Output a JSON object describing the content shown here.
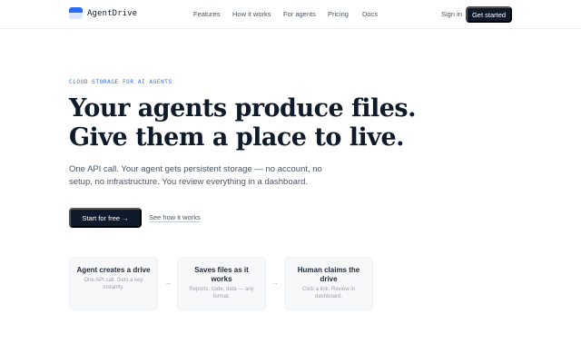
{
  "brand": {
    "name": "AgentDrive"
  },
  "nav": {
    "links": [
      "Features",
      "How it works",
      "For agents",
      "Pricing",
      "Docs"
    ],
    "signin": "Sign in",
    "cta": "Get started"
  },
  "hero": {
    "eyebrow": "CLOUD STORAGE FOR AI AGENTS",
    "headline_line1": "Your agents produce files.",
    "headline_line2": "Give them a place to live.",
    "subtitle": "One API call. Your agent gets persistent storage — no account, no setup, no infrastructure. You review everything in a dashboard.",
    "primary_cta": "Start for free →",
    "secondary_cta": "See how it works"
  },
  "steps": [
    {
      "title": "Agent creates a drive",
      "desc": "One API call. Gets a key instantly."
    },
    {
      "title": "Saves files as it works",
      "desc": "Reports, code, data — any format."
    },
    {
      "title": "Human claims the drive",
      "desc": "Click a link. Review in dashboard."
    }
  ],
  "step_arrow": "→",
  "colors": {
    "accent": "#2b6cf6",
    "dark_button": "#0f1a2b",
    "card_bg": "#f7f8fa"
  }
}
